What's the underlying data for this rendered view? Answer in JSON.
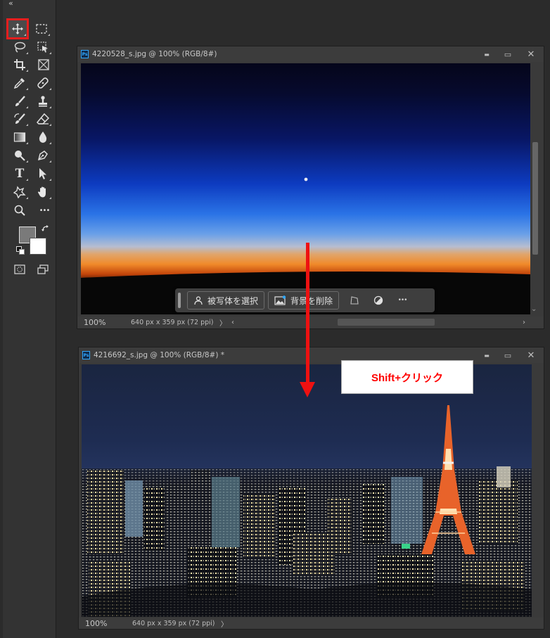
{
  "toolbar": {
    "collapse_glyph": "«",
    "tools": [
      {
        "name": "move-tool",
        "icon": "move-icon",
        "active": true
      },
      {
        "name": "marquee-tool",
        "icon": "rect-marquee-icon"
      },
      {
        "name": "lasso-tool",
        "icon": "lasso-icon"
      },
      {
        "name": "object-select-tool",
        "icon": "object-select-icon"
      },
      {
        "name": "crop-tool",
        "icon": "crop-icon"
      },
      {
        "name": "frame-tool",
        "icon": "frame-icon"
      },
      {
        "name": "eyedropper-tool",
        "icon": "eyedropper-icon"
      },
      {
        "name": "healing-brush-tool",
        "icon": "bandage-icon"
      },
      {
        "name": "brush-tool",
        "icon": "brush-icon"
      },
      {
        "name": "clone-stamp-tool",
        "icon": "stamp-icon"
      },
      {
        "name": "history-brush-tool",
        "icon": "history-brush-icon"
      },
      {
        "name": "eraser-tool",
        "icon": "eraser-icon"
      },
      {
        "name": "gradient-tool",
        "icon": "gradient-icon"
      },
      {
        "name": "blur-tool",
        "icon": "drop-icon"
      },
      {
        "name": "dodge-tool",
        "icon": "dodge-icon"
      },
      {
        "name": "pen-tool",
        "icon": "pen-icon"
      },
      {
        "name": "type-tool",
        "icon": "type-icon"
      },
      {
        "name": "path-select-tool",
        "icon": "arrow-select-icon"
      },
      {
        "name": "shape-tool",
        "icon": "custom-shape-icon"
      },
      {
        "name": "hand-tool",
        "icon": "hand-icon"
      },
      {
        "name": "zoom-tool",
        "icon": "zoom-icon"
      },
      {
        "name": "more-tools",
        "icon": "more-icon"
      },
      {
        "name": "quick-mask",
        "icon": "quick-mask-icon"
      },
      {
        "name": "screen-mode",
        "icon": "screen-mode-icon"
      }
    ],
    "type_tool_glyph": "T",
    "more_glyph": "•••",
    "colors": {
      "foreground": "#7a7a7a",
      "background": "#ffffff"
    },
    "active_highlight": "#e41e1e"
  },
  "doc1": {
    "title": "4220528_s.jpg @ 100% (RGB/8#)",
    "ps_badge": "Ps",
    "zoom": "100%",
    "info": "640 px x 359 px (72 ppi)",
    "chevron": "〉",
    "scroll_left": "‹",
    "scroll_right": "›",
    "scroll_down": "⌄",
    "win_minimize": "▬",
    "win_maximize": "▭",
    "win_close": "✕"
  },
  "doc2": {
    "title": "4216692_s.jpg @ 100% (RGB/8#) *",
    "ps_badge": "Ps",
    "zoom": "100%",
    "info": "640 px x 359 px (72 ppi)",
    "chevron": "〉",
    "win_minimize": "▬",
    "win_maximize": "▭",
    "win_close": "✕"
  },
  "taskbar": {
    "select_subject": "被写体を選択",
    "remove_background": "背景を削除",
    "more_glyph": "•••"
  },
  "annotation": {
    "callout_text": "Shift+クリック",
    "arrow_color": "#ee1111",
    "callout_text_color": "#ff0000"
  }
}
